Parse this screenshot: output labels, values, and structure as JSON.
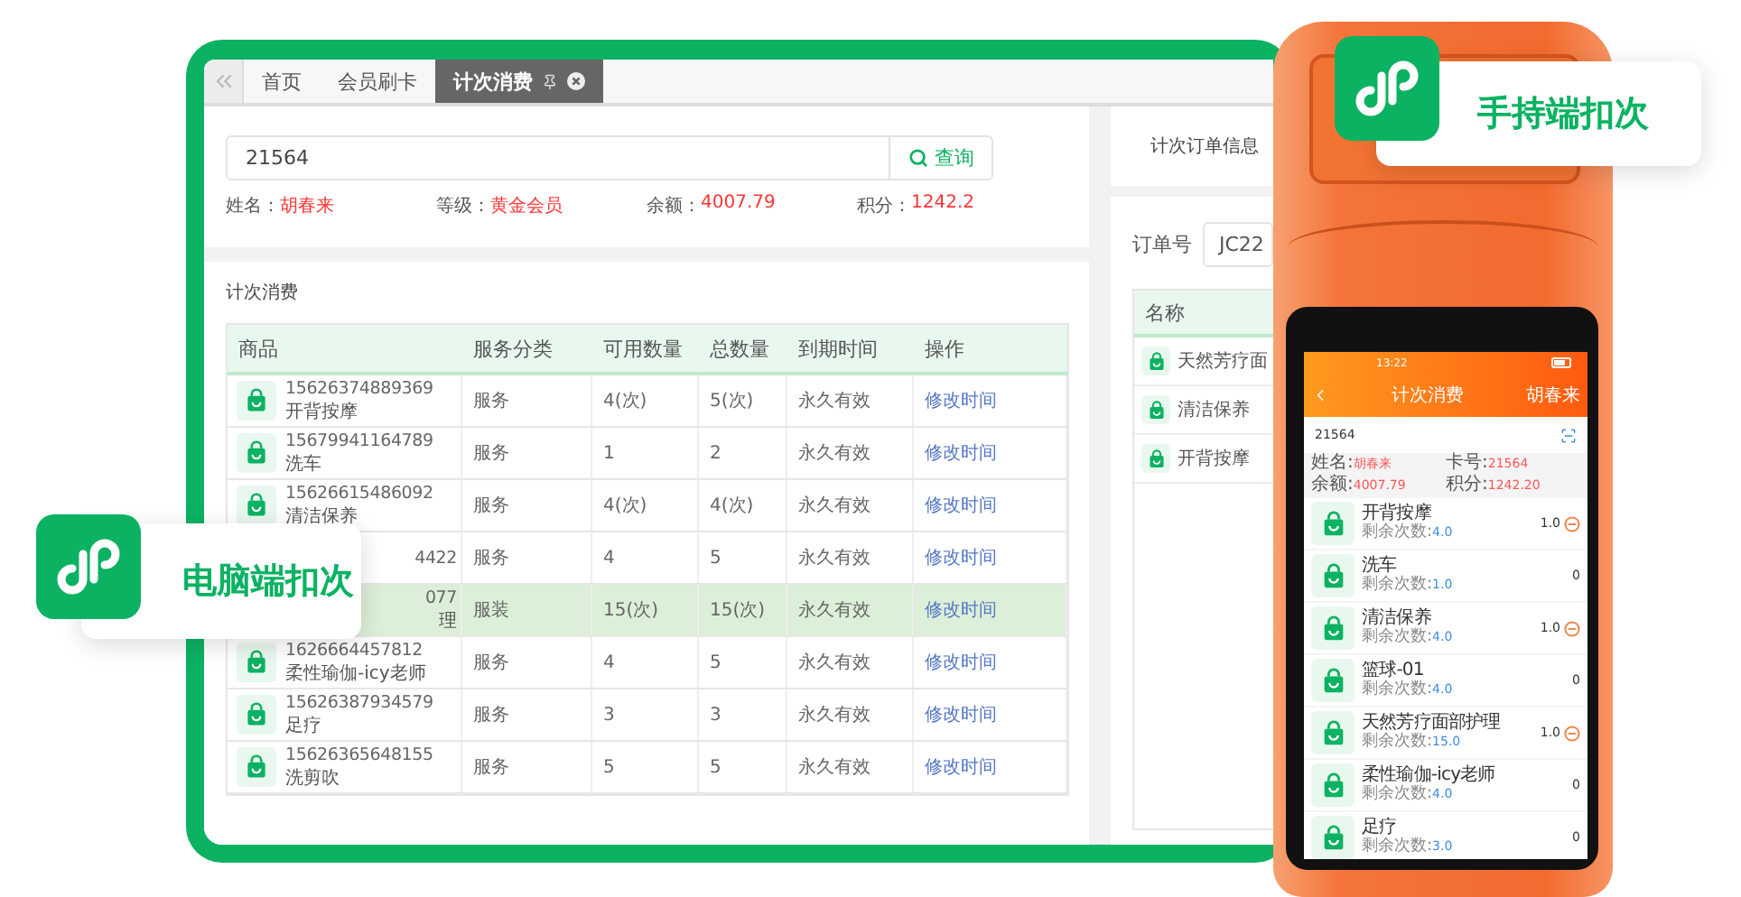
{
  "desktop": {
    "tabs": [
      {
        "label": "首页",
        "selected": false
      },
      {
        "label": "会员刷卡",
        "selected": false
      },
      {
        "label": "计次消费",
        "selected": true
      }
    ],
    "search": {
      "value": "21564",
      "button": "查询"
    },
    "member_info": [
      {
        "label": "姓名：",
        "value": "胡春来"
      },
      {
        "label": "等级：",
        "value": "黄金会员"
      },
      {
        "label": "余额：",
        "value": "4007.79"
      },
      {
        "label": "积分：",
        "value": "1242.2"
      }
    ],
    "section_title": "计次消费",
    "table": {
      "columns": [
        "商品",
        "服务分类",
        "可用数量",
        "总数量",
        "到期时间",
        "操作"
      ],
      "rows": [
        {
          "code": "15626374889369",
          "name": "开背按摩",
          "covered": false,
          "category": "服务",
          "available": "4(次)",
          "total": "5(次)",
          "expiry": "永久有效",
          "action": "修改时间",
          "selected": false
        },
        {
          "code": "15679941164789",
          "name": "洗车",
          "covered": false,
          "category": "服务",
          "available": "1",
          "total": "2",
          "expiry": "永久有效",
          "action": "修改时间",
          "selected": false
        },
        {
          "code": "15626615486092",
          "name": "清洁保养",
          "covered": false,
          "category": "服务",
          "available": "4(次)",
          "total": "4(次)",
          "expiry": "永久有效",
          "action": "修改时间",
          "selected": false
        },
        {
          "code": "4422",
          "covered": true,
          "category": "服务",
          "available": "4",
          "total": "5",
          "expiry": "永久有效",
          "action": "修改时间",
          "selected": false
        },
        {
          "code": "077",
          "name_tail": "理",
          "covered": true,
          "category": "服装",
          "available": "15(次)",
          "total": "15(次)",
          "expiry": "永久有效",
          "action": "修改时间",
          "selected": true
        },
        {
          "code": "1626664457812",
          "name": "柔性瑜伽-icy老师",
          "covered": false,
          "category": "服务",
          "available": "4",
          "total": "5",
          "expiry": "永久有效",
          "action": "修改时间",
          "selected": false
        },
        {
          "code": "15626387934579",
          "name": "足疗",
          "covered": false,
          "category": "服务",
          "available": "3",
          "total": "3",
          "expiry": "永久有效",
          "action": "修改时间",
          "selected": false
        },
        {
          "code": "15626365648155",
          "name": "洗剪吹",
          "covered": false,
          "category": "服务",
          "available": "5",
          "total": "5",
          "expiry": "永久有效",
          "action": "修改时间",
          "selected": false
        }
      ]
    },
    "order_panel": {
      "title": "计次订单信息",
      "order_label": "订单号",
      "order_value": "JC22",
      "column": "名称",
      "rows": [
        "天然芳疗面",
        "清洁保养",
        "开背按摩"
      ]
    }
  },
  "phone": {
    "time": "13:22",
    "title": "计次消费",
    "user": "胡春来",
    "search": "21564",
    "info": [
      {
        "label": "姓名:",
        "value": "胡春来"
      },
      {
        "label": "卡号:",
        "value": "21564"
      },
      {
        "label": "余额:",
        "value": "4007.79"
      },
      {
        "label": "积分:",
        "value": "1242.20"
      }
    ],
    "items": [
      {
        "name": "开背按摩",
        "remaining_label": "剩余次数:",
        "remaining": "4.0",
        "count": "1.0",
        "minus": true
      },
      {
        "name": "洗车",
        "remaining_label": "剩余次数:",
        "remaining": "1.0",
        "count": "0",
        "minus": false
      },
      {
        "name": "清洁保养",
        "remaining_label": "剩余次数:",
        "remaining": "4.0",
        "count": "1.0",
        "minus": true
      },
      {
        "name": "篮球-01",
        "remaining_label": "剩余次数:",
        "remaining": "4.0",
        "count": "0",
        "minus": false
      },
      {
        "name": "天然芳疗面部护理",
        "remaining_label": "剩余次数:",
        "remaining": "15.0",
        "count": "1.0",
        "minus": true
      },
      {
        "name": "柔性瑜伽-icy老师",
        "remaining_label": "剩余次数:",
        "remaining": "4.0",
        "count": "0",
        "minus": false
      },
      {
        "name": "足疗",
        "remaining_label": "剩余次数:",
        "remaining": "3.0",
        "count": "0",
        "minus": false
      }
    ]
  },
  "badges": [
    {
      "label": "电脑端扣次"
    },
    {
      "label": "手持端扣次"
    }
  ]
}
